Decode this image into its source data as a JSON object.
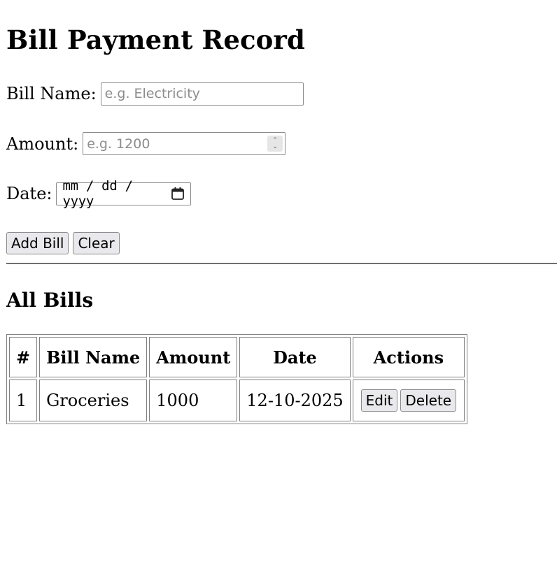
{
  "page": {
    "title": "Bill Payment Record"
  },
  "form": {
    "bill_name_label": "Bill Name:",
    "bill_name_placeholder": "e.g. Electricity",
    "bill_name_value": "",
    "amount_label": "Amount:",
    "amount_placeholder": "e.g. 1200",
    "amount_value": "",
    "date_label": "Date:",
    "date_format": "mm / dd / yyyy",
    "add_button": "Add Bill",
    "clear_button": "Clear"
  },
  "section": {
    "heading": "All Bills"
  },
  "table": {
    "headers": [
      "#",
      "Bill Name",
      "Amount",
      "Date",
      "Actions"
    ],
    "rows": [
      {
        "index": "1",
        "bill_name": "Groceries",
        "amount": "1000",
        "date": "12-10-2025",
        "edit_label": "Edit",
        "delete_label": "Delete"
      }
    ]
  },
  "icons": {
    "spinner": "number-spinner-icon",
    "calendar": "calendar-icon"
  }
}
